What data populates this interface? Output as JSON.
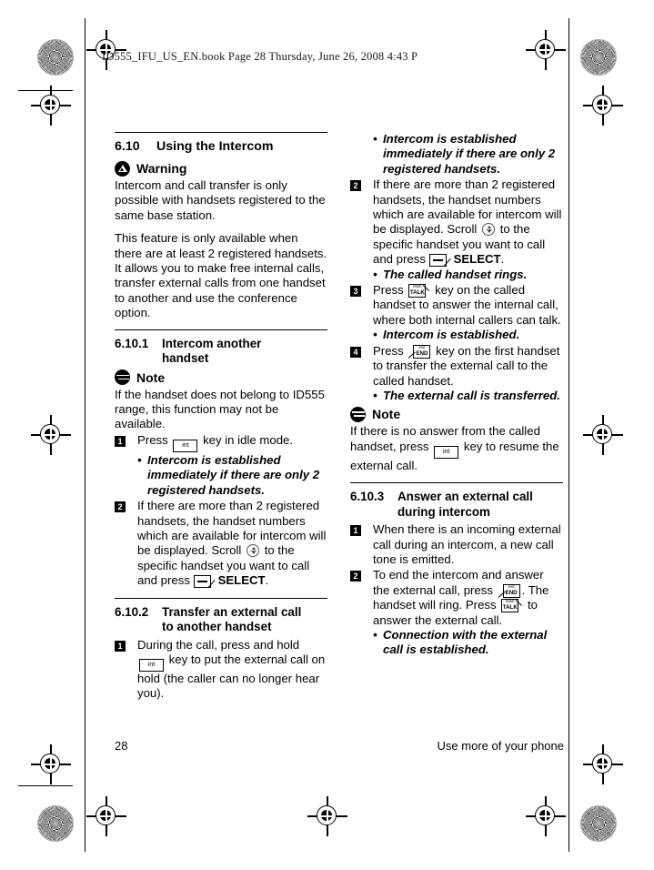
{
  "header": {
    "file_line": "ID555_IFU_US_EN.book   Page 28   Thursday, June 26, 2008   4:43 P"
  },
  "footer": {
    "page_number": "28",
    "running_title": "Use more of your phone"
  },
  "keys": {
    "int": "int",
    "talk_top": "flash",
    "talk_main": "TALK",
    "end_top": "exit",
    "end_main": "END",
    "select_label": "SELECT"
  },
  "left_column": {
    "section": {
      "number": "6.10",
      "title": "Using the Intercom"
    },
    "warning": {
      "label": "Warning",
      "text": "Intercom and call transfer is only possible with handsets registered to the same base station."
    },
    "intro_paragraph": "This feature is only available when there are at least 2 registered handsets. It allows you to make free internal calls, transfer external calls from one handset to another and use the conference option.",
    "subsection_1": {
      "number": "6.10.1",
      "title_line_1": "Intercom another",
      "title_line_2": "handset"
    },
    "note": {
      "label": "Note",
      "text": "If the handset does not belong to ID555 range, this function may not be available."
    },
    "step_1": {
      "marker": "1",
      "text_before_key": "Press",
      "text_after_key": "key in idle mode.",
      "bullet": "Intercom is established immediately if there are only 2 registered handsets."
    },
    "step_2": {
      "marker": "2",
      "text_part_1": "If there are more than 2 registered handsets, the handset numbers which are available for intercom will be displayed. Scroll",
      "text_part_2": "to the specific handset you want to call and press",
      "text_end": "."
    },
    "subsection_2": {
      "number": "6.10.2",
      "title_line_1": "Transfer an external call",
      "title_line_2": "to another handset",
      "step_1": {
        "marker": "1",
        "text_before_key": "During the call, press and hold",
        "text_after_key": "key to put the external call on hold (the caller can no longer hear you)."
      }
    }
  },
  "right_column": {
    "top_bullet": "Intercom is established immediately if there are only 2 registered handsets.",
    "step_2": {
      "marker": "2",
      "text_part_1": "If there are more than 2 registered handsets, the handset numbers which are available for intercom will be displayed. Scroll",
      "text_part_2": "to the specific handset you want to call and press",
      "text_end": ".",
      "bullet": "The called handset rings."
    },
    "step_3": {
      "marker": "3",
      "text_before_key": "Press",
      "text_after_key": "key on the called handset to answer the internal call, where both internal callers can talk.",
      "bullet": "Intercom is established."
    },
    "step_4": {
      "marker": "4",
      "text_before_key": "Press",
      "text_after_key": "key on the first handset to transfer the external call to the called handset.",
      "bullet": "The external call is transferred."
    },
    "note": {
      "label": "Note",
      "text_before_key": "If there is no answer from the called handset, press",
      "text_after_key": "key to resume the external call."
    },
    "subsection_3": {
      "number": "6.10.3",
      "title_line_1": "Answer an external call",
      "title_line_2": "during intercom",
      "step_1": {
        "marker": "1",
        "text": "When there is an incoming external call during an intercom, a new call tone is emitted."
      },
      "step_2": {
        "marker": "2",
        "text_part_1": "To end the intercom and answer the external call, press",
        "text_part_2": ". The handset will ring. Press",
        "text_part_3": "to answer the external call.",
        "bullet": "Connection with the external call is established."
      }
    }
  }
}
